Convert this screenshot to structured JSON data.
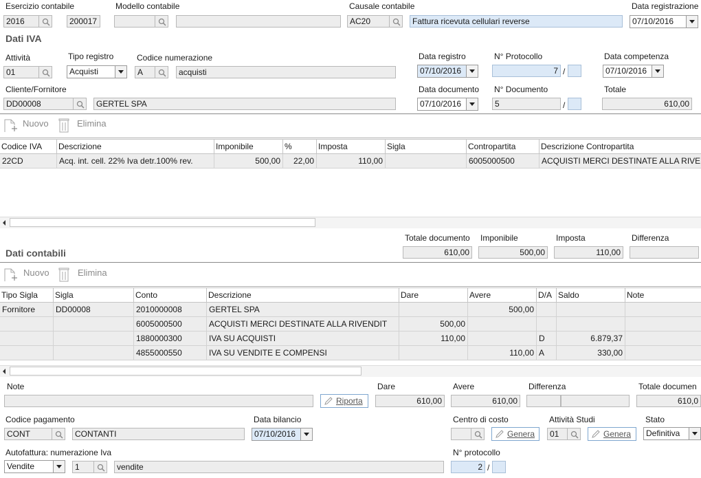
{
  "header": {
    "esercizio_label": "Esercizio contabile",
    "esercizio_year": "2016",
    "esercizio_num": "200017",
    "modello_label": "Modello contabile",
    "modello_code": "",
    "modello_desc": "",
    "causale_label": "Causale contabile",
    "causale_code": "AC20",
    "causale_desc": "Fattura ricevuta cellulari reverse",
    "data_reg_label": "Data registrazione",
    "data_reg_value": "07/10/2016"
  },
  "iva": {
    "section_title": "Dati IVA",
    "attivita_label": "Attività",
    "attivita_value": "01",
    "tipo_registro_label": "Tipo registro",
    "tipo_registro_value": "Acquisti",
    "codice_num_label": "Codice numerazione",
    "codice_num_code": "A",
    "codice_num_desc": "acquisti",
    "data_registro_label": "Data registro",
    "data_registro_value": "07/10/2016",
    "protocollo_label": "N° Protocollo",
    "protocollo_value": "7",
    "protocollo_suffix": "",
    "data_comp_label": "Data competenza",
    "data_comp_value": "07/10/2016",
    "cliente_label": "Cliente/Fornitore",
    "cliente_code": "DD00008",
    "cliente_name": "GERTEL SPA",
    "data_doc_label": "Data documento",
    "data_doc_value": "07/10/2016",
    "num_doc_label": "N° Documento",
    "num_doc_value": "5",
    "num_doc_suffix": "",
    "totale_label": "Totale",
    "totale_value": "610,00",
    "nuovo_label": "Nuovo",
    "elimina_label": "Elimina",
    "columns": [
      "Codice IVA",
      "Descrizione",
      "Imponibile",
      "%",
      "Imposta",
      "Sigla",
      "Contropartita",
      "Descrizione Contropartita"
    ],
    "rows": [
      [
        "22CD",
        "Acq. int. cell. 22% Iva detr.100% rev.",
        "500,00",
        "22,00",
        "110,00",
        "",
        "6005000500",
        "ACQUISTI MERCI DESTINATE ALLA RIVEN"
      ]
    ]
  },
  "contabili": {
    "section_title": "Dati contabili",
    "totale_doc_label": "Totale documento",
    "totale_doc_value": "610,00",
    "imponibile_label": "Imponibile",
    "imponibile_value": "500,00",
    "imposta_label": "Imposta",
    "imposta_value": "110,00",
    "differenza_label": "Differenza",
    "differenza_value": "",
    "nuovo_label": "Nuovo",
    "elimina_label": "Elimina",
    "columns": [
      "Tipo Sigla",
      "Sigla",
      "Conto",
      "Descrizione",
      "Dare",
      "Avere",
      "D/A",
      "Saldo",
      "Note"
    ],
    "rows": [
      [
        "Fornitore",
        "DD00008",
        "2010000008",
        "GERTEL SPA",
        "",
        "500,00",
        "",
        "",
        ""
      ],
      [
        "",
        "",
        "6005000500",
        "ACQUISTI MERCI DESTINATE ALLA RIVENDIT",
        "500,00",
        "",
        "",
        "",
        ""
      ],
      [
        "",
        "",
        "1880000300",
        "IVA SU ACQUISTI",
        "110,00",
        "",
        "D",
        "6.879,37",
        ""
      ],
      [
        "",
        "",
        "4855000550",
        "IVA SU VENDITE E COMPENSI",
        "",
        "110,00",
        "A",
        "330,00",
        ""
      ]
    ]
  },
  "footer": {
    "note_label": "Note",
    "note_value": "",
    "riporta_label": "Riporta",
    "dare_label": "Dare",
    "dare_value": "610,00",
    "avere_label": "Avere",
    "avere_value": "610,00",
    "differenza_label": "Differenza",
    "totale_doc_label": "Totale documen",
    "totale_doc_value": "610,0",
    "cod_pag_label": "Codice pagamento",
    "cod_pag_code": "CONT",
    "cod_pag_desc": "CONTANTI",
    "data_bilancio_label": "Data bilancio",
    "data_bilancio_value": "07/10/2016",
    "centro_costo_label": "Centro di costo",
    "genera_label": "Genera",
    "attivita_studi_label": "Attività Studi",
    "attivita_studi_value": "01",
    "genera2_label": "Genera",
    "stato_label": "Stato",
    "stato_value": "Definitiva",
    "autofattura_label": "Autofattura: numerazione Iva",
    "autofattura_type": "Vendite",
    "autofattura_code": "1",
    "autofattura_desc": "vendite",
    "nprot_label": "N° protocollo",
    "nprot_value": "2",
    "nprot_suffix": ""
  }
}
